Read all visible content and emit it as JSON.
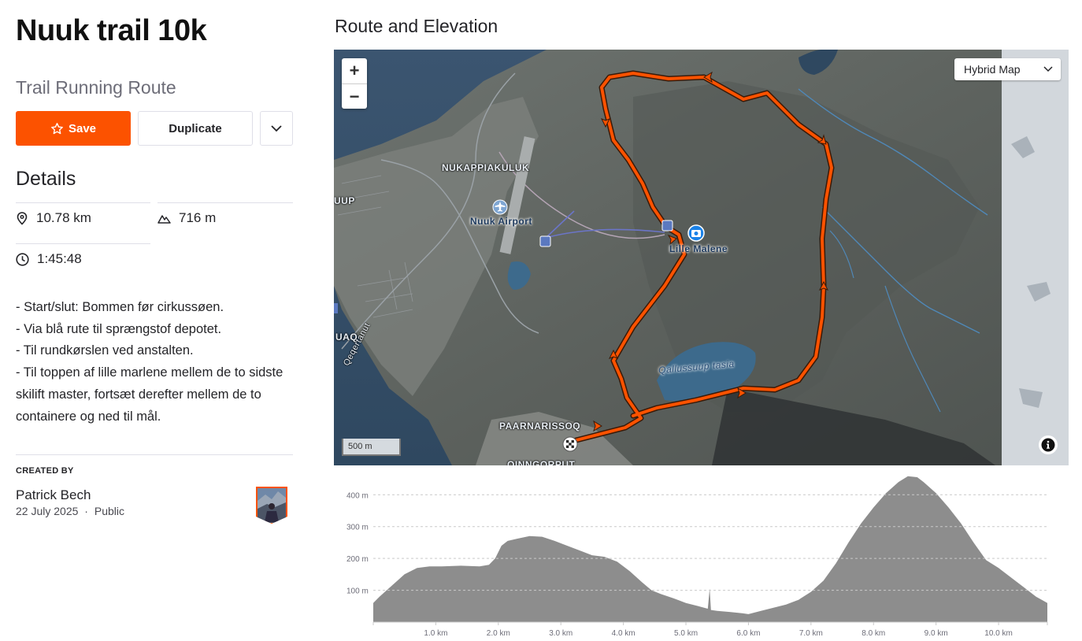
{
  "route": {
    "title": "Nuuk trail 10k",
    "type": "Trail Running Route"
  },
  "actions": {
    "save_label": "Save",
    "duplicate_label": "Duplicate",
    "more_icon": "chevron-down-icon"
  },
  "details": {
    "heading": "Details",
    "distance": "10.78 km",
    "elevation": "716 m",
    "time": "1:45:48",
    "icons": {
      "distance": "map-pin-icon",
      "elevation": "mountain-icon",
      "time": "clock-icon"
    }
  },
  "description": [
    "- Start/slut: Bommen før cirkussøen.",
    "- Via blå rute til sprængstof depotet.",
    "- Til rundkørslen ved anstalten.",
    "- Til toppen af lille marlene mellem de to sidste skilift master, fortsæt derefter mellem de to containere og ned til mål."
  ],
  "creator": {
    "label": "CREATED BY",
    "name": "Patrick Bech",
    "date": "22 July 2025",
    "separator": "·",
    "visibility": "Public"
  },
  "map": {
    "section_title": "Route and Elevation",
    "map_type": "Hybrid Map",
    "scale_label": "500 m",
    "zoom_in": "+",
    "zoom_out": "−",
    "route_color": "#fc5200",
    "labels": {
      "nukappiakuluk": "NUKAPPIAKULUK",
      "nuuk_airport": "Nuuk Airport",
      "lille_malene": "Lille Malene",
      "qallussuup_tasia": "Qallussuup tasia",
      "paarnarissoq": "PAARNARISSOQ",
      "qinngorput": "QINNGORPUT",
      "uup": "UUP",
      "uaq": "UAQ",
      "qeqertanut": "Qeqertanut"
    }
  },
  "chart_data": {
    "type": "area",
    "xlabel": "",
    "ylabel": "",
    "x_unit": "km",
    "xlim": [
      0,
      10.78
    ],
    "ylim": [
      0,
      460
    ],
    "x_ticks": [
      "1.0 km",
      "2.0 km",
      "3.0 km",
      "4.0 km",
      "5.0 km",
      "6.0 km",
      "7.0 km",
      "8.0 km",
      "9.0 km",
      "10.0 km"
    ],
    "y_ticks": [
      "100 m",
      "200 m",
      "300 m",
      "400 m"
    ],
    "y_tick_values": [
      100,
      200,
      300,
      400
    ],
    "x_tick_values": [
      1,
      2,
      3,
      4,
      5,
      6,
      7,
      8,
      9,
      10
    ],
    "grid": true,
    "fill_color": "#8d8d8d",
    "x": [
      0,
      0.1,
      0.3,
      0.5,
      0.7,
      0.9,
      1.1,
      1.4,
      1.7,
      1.85,
      1.95,
      2.05,
      2.15,
      2.3,
      2.5,
      2.7,
      2.9,
      3.1,
      3.3,
      3.5,
      3.7,
      3.9,
      4.1,
      4.3,
      4.45,
      4.6,
      4.8,
      5.0,
      5.2,
      5.35,
      5.38,
      5.4,
      5.5,
      5.7,
      5.9,
      6.0,
      6.2,
      6.4,
      6.6,
      6.8,
      7.0,
      7.2,
      7.4,
      7.6,
      7.8,
      8.0,
      8.2,
      8.4,
      8.55,
      8.7,
      8.8,
      9.0,
      9.2,
      9.4,
      9.6,
      9.8,
      10.0,
      10.2,
      10.4,
      10.6,
      10.78
    ],
    "y": [
      60,
      80,
      115,
      150,
      170,
      175,
      175,
      177,
      175,
      180,
      200,
      240,
      255,
      262,
      270,
      268,
      255,
      240,
      225,
      210,
      205,
      190,
      160,
      125,
      100,
      88,
      75,
      60,
      50,
      42,
      105,
      38,
      35,
      32,
      28,
      25,
      35,
      45,
      55,
      70,
      95,
      130,
      185,
      250,
      310,
      360,
      405,
      440,
      458,
      455,
      440,
      405,
      360,
      310,
      250,
      195,
      170,
      140,
      110,
      80,
      60
    ]
  }
}
